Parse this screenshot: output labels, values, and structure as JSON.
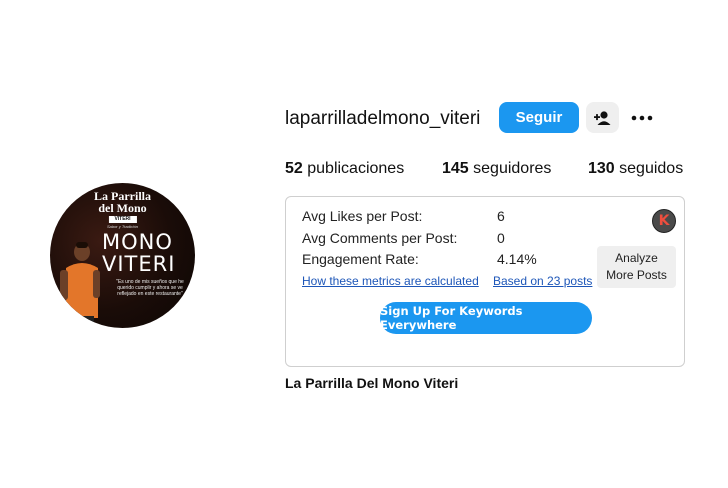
{
  "profile": {
    "username": "laparrilladelmono_viteri",
    "full_name": "La Parrilla Del Mono Viteri",
    "follow_label": "Seguir",
    "follow_color": "#1b97f0",
    "add_person_icon": "add-person-icon",
    "more_icon": "more-options-icon"
  },
  "stats": {
    "posts_count": "52",
    "posts_label": "publicaciones",
    "followers_count": "145",
    "followers_label": "seguidores",
    "following_count": "130",
    "following_label": "seguidos"
  },
  "avatar": {
    "brand_line1": "La Parrilla",
    "brand_line2": "del Mono",
    "tag": "VITERI",
    "subtitle": "Sabor y Tradición",
    "big_line1": "MONO",
    "big_line2": "VITERI",
    "quote": "\"Es uno de mis sueños que he querido cumplir y ahora se ve reflejado en este restaurante\""
  },
  "metrics": {
    "avg_likes_label": "Avg Likes per Post:",
    "avg_likes_value": "6",
    "avg_comments_label": "Avg Comments per Post:",
    "avg_comments_value": "0",
    "engagement_label": "Engagement Rate:",
    "engagement_value": "4.14%",
    "how_link": "How these metrics are calculated",
    "based_link": "Based on 23 posts",
    "analyze_line1": "Analyze",
    "analyze_line2": "More Posts",
    "signup_label": "Sign Up For Keywords Everywhere",
    "badge_letter": "K",
    "badge_color": "#ef4e3e"
  }
}
